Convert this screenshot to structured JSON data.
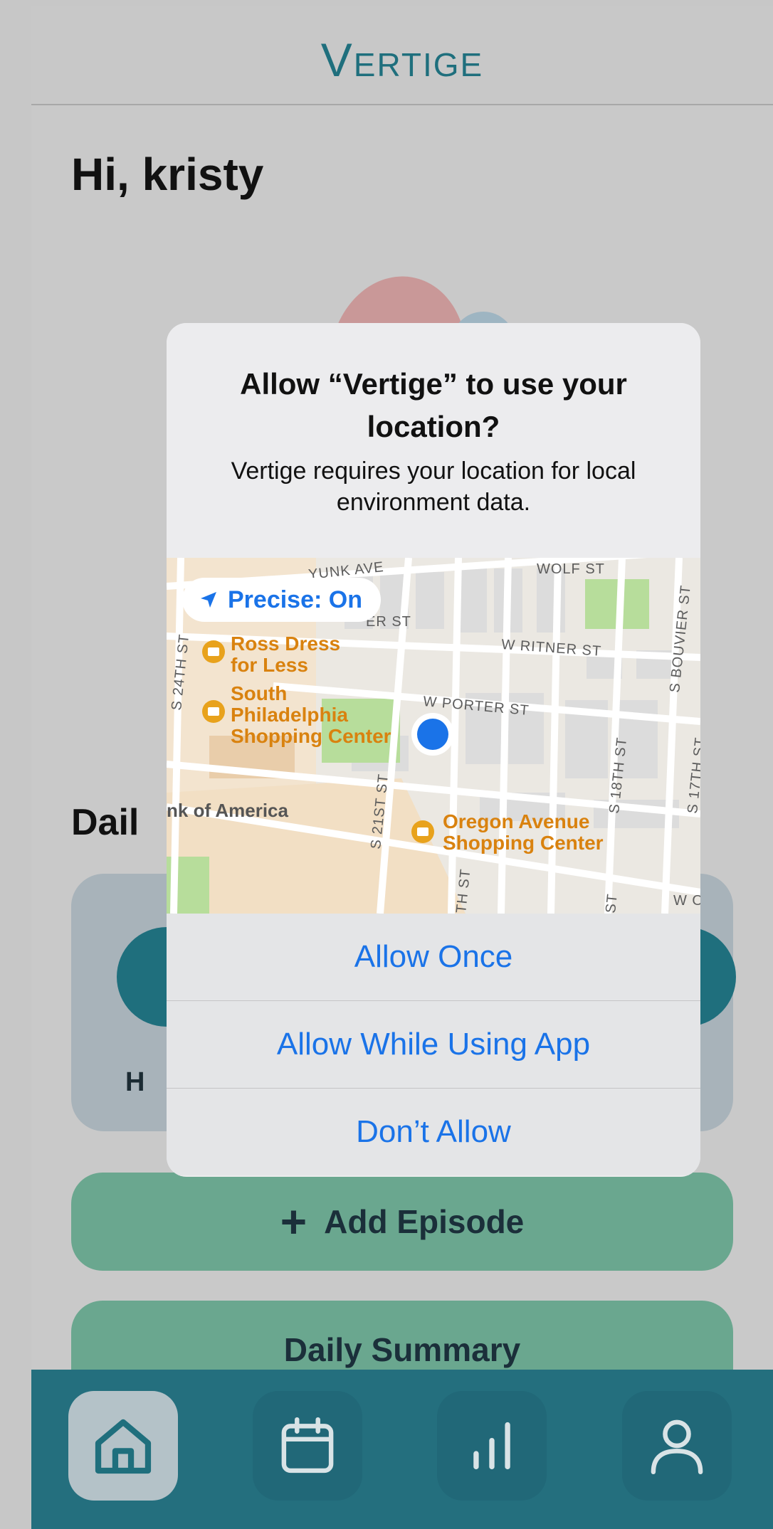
{
  "app": {
    "title": "Vertige",
    "greeting": "Hi, kristy",
    "section_label_partial": "Dail",
    "card_letter": "H",
    "add_episode_label": "Add Episode",
    "daily_summary_label": "Daily Summary"
  },
  "dialog": {
    "title": "Allow “Vertige” to use your location?",
    "message": "Vertige requires your location for local environment data.",
    "precise_label": "Precise: On",
    "actions": [
      "Allow Once",
      "Allow While Using App",
      "Don’t Allow"
    ]
  },
  "map": {
    "streets": [
      "WOLF ST",
      "W RITNER ST",
      "W PORTER ST",
      "S 24TH ST",
      "S 21ST ST",
      "S 18TH ST",
      "S BOUVIER ST",
      "S 17TH ST",
      "ER ST",
      "YUNK AVE",
      "TH ST",
      "ST",
      "W O"
    ],
    "places": [
      {
        "name": "Ross Dress for Less",
        "lines": [
          "Ross Dress",
          "for Less"
        ]
      },
      {
        "name": "South Philadelphia Shopping Center",
        "lines": [
          "South",
          "Philadelphia",
          "Shopping Center"
        ]
      },
      {
        "name": "Oregon Avenue Shopping Center",
        "lines": [
          "Oregon Avenue",
          "Shopping Center"
        ]
      },
      {
        "name": "nk of America",
        "lines": [
          "nk of America"
        ]
      }
    ]
  },
  "tabs": [
    {
      "name": "home",
      "active": true
    },
    {
      "name": "calendar",
      "active": false
    },
    {
      "name": "stats",
      "active": false
    },
    {
      "name": "profile",
      "active": false
    }
  ],
  "colors": {
    "brand_teal": "#1f6f7d",
    "button_green": "#6aa78f",
    "ios_blue": "#1a73e8"
  }
}
